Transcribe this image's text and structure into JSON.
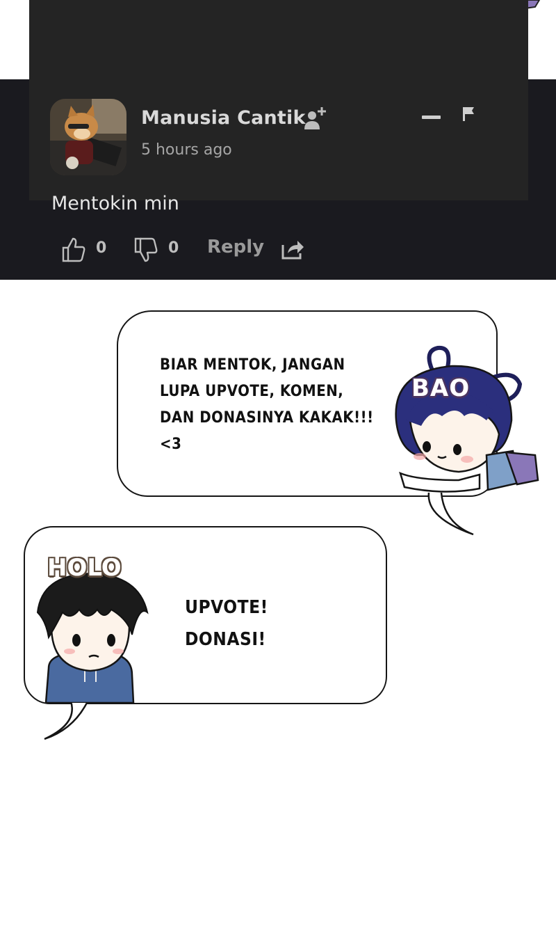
{
  "comment": {
    "author": "Manusia Cantik",
    "timestamp": "5 hours ago",
    "text": "Mentokin min",
    "likes": "0",
    "dislikes": "0",
    "reply_label": "Reply",
    "icons": [
      "follow-user-icon",
      "collapse-icon",
      "flag-icon",
      "thumbs-up-icon",
      "thumbs-down-icon",
      "share-icon"
    ],
    "avatar": "dog-avatar"
  },
  "bao": {
    "name": "BAO",
    "line1": "BIAR MENTOK, JANGAN",
    "line2": "LUPA UPVOTE, KOMEN,",
    "line3": "DAN DONASINYA KAKAK!!!",
    "line4": "<3"
  },
  "holo": {
    "name": "HOLO",
    "line1": "UPVOTE!",
    "line2": "DONASI!"
  },
  "colors": {
    "panel_bg": "#242424",
    "panel_outer": "#1a1a1f",
    "text_primary": "#d9d9d9",
    "text_secondary": "#a6a6a6"
  }
}
